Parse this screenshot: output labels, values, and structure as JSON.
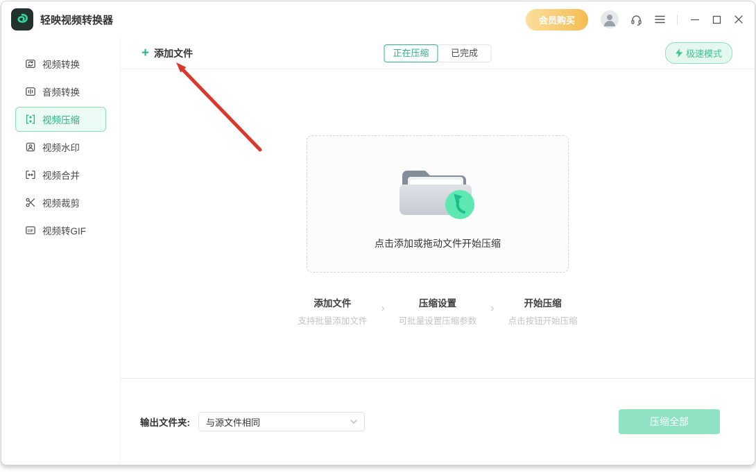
{
  "app": {
    "title": "轻映视频转换器",
    "logo_icon": "green-swirl-logo"
  },
  "titlebar": {
    "vip_label": "会员购买",
    "icons": {
      "avatar": "user-avatar-icon",
      "support": "headset-icon",
      "menu": "hamburger-menu-icon",
      "minimize": "minimize-icon",
      "maximize": "maximize-icon",
      "close": "close-icon"
    }
  },
  "sidebar": {
    "items": [
      {
        "label": "视频转换",
        "icon": "video-convert-icon",
        "active": false
      },
      {
        "label": "音频转换",
        "icon": "audio-convert-icon",
        "active": false
      },
      {
        "label": "视频压缩",
        "icon": "video-compress-icon",
        "active": true
      },
      {
        "label": "视频水印",
        "icon": "video-watermark-icon",
        "active": false
      },
      {
        "label": "视频合并",
        "icon": "video-merge-icon",
        "active": false
      },
      {
        "label": "视频裁剪",
        "icon": "video-trim-icon",
        "active": false
      },
      {
        "label": "视频转GIF",
        "icon": "video-to-gif-icon",
        "active": false
      }
    ]
  },
  "content": {
    "add_files_label": "添加文件",
    "add_files_plus": "+",
    "tabs": [
      {
        "label": "正在压缩",
        "active": true
      },
      {
        "label": "已完成",
        "active": false
      }
    ],
    "turbo_label": "极速模式",
    "dropzone_hint": "点击添加或拖动文件开始压缩",
    "dropzone_icon": "folder-upload-icon",
    "step_separator": "›",
    "steps": [
      {
        "title": "添加文件",
        "subtitle": "支持批量添加文件"
      },
      {
        "title": "压缩设置",
        "subtitle": "可批量设置压缩参数"
      },
      {
        "title": "开始压缩",
        "subtitle": "点击按钮开始压缩"
      }
    ]
  },
  "footer": {
    "output_folder_label": "输出文件夹:",
    "output_folder_value": "与源文件相同",
    "compress_all_label": "压缩全部"
  },
  "annotation": {
    "arrow": "red-arrow-pointing-to-add-files"
  },
  "colors": {
    "primary_green": "#2db486",
    "active_item_bg": "#ebfaf3",
    "active_item_border": "#8edcba",
    "turbo_bg": "#e4f8ef",
    "vip_gradient_start": "#fbdf9d",
    "vip_gradient_end": "#f4bc50",
    "compress_all_bg": "#8fe3c3",
    "arrow_red": "#d9382b"
  }
}
